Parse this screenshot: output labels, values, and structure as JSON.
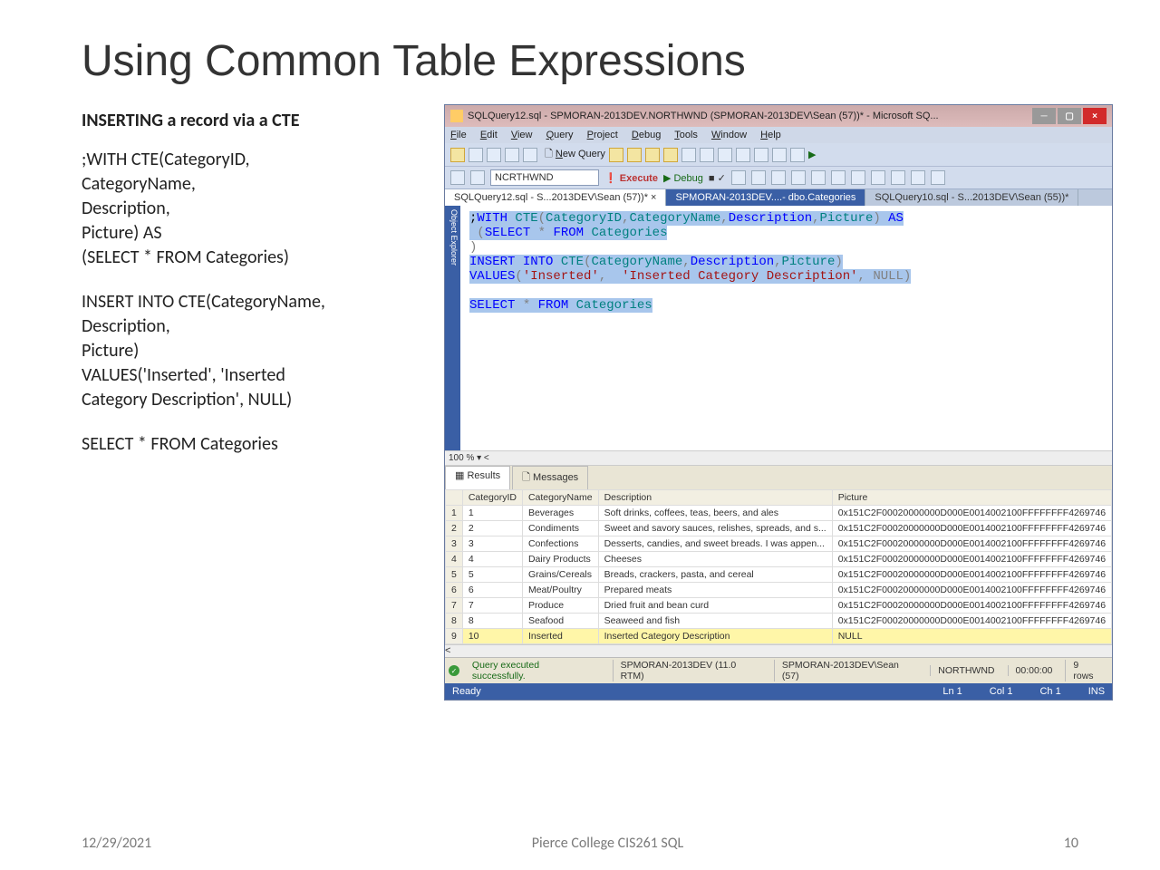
{
  "slide": {
    "title": "Using Common Table Expressions",
    "subheading": "INSERTING a record via a CTE",
    "codeblock1": ";WITH CTE(CategoryID,\nCategoryName,\nDescription,\nPicture) AS\n(SELECT * FROM Categories)",
    "codeblock2": "INSERT INTO CTE(CategoryName,\nDescription,\nPicture)\nVALUES('Inserted', 'Inserted\nCategory Description', NULL)",
    "codeblock3": "SELECT * FROM Categories",
    "footer_date": "12/29/2021",
    "footer_center": "Pierce College CIS261 SQL",
    "footer_page": "10"
  },
  "ssms": {
    "title": "SQLQuery12.sql - SPMORAN-2013DEV.NORTHWND (SPMORAN-2013DEV\\Sean (57))* - Microsoft SQ...",
    "menu": {
      "file": "File",
      "edit": "Edit",
      "view": "View",
      "query": "Query",
      "project": "Project",
      "debug": "Debug",
      "tools": "Tools",
      "window": "Window",
      "help": "Help"
    },
    "newquery": "New Query",
    "db": "NCRTHWND",
    "execute": "Execute",
    "debug": "Debug",
    "tabs": {
      "t1": "SQLQuery12.sql - S...2013DEV\\Sean (57))*",
      "t2": "SPMORAN-2013DEV....- dbo.Categories",
      "t3": "SQLQuery10.sql - S...2013DEV\\Sean (55))*"
    },
    "objexp": "Object Explorer",
    "zoom": "100 %",
    "restabs": {
      "results": "Results",
      "messages": "Messages"
    },
    "columns": {
      "c1": "CategoryID",
      "c2": "CategoryName",
      "c3": "Description",
      "c4": "Picture"
    },
    "rows": [
      {
        "n": "1",
        "id": "1",
        "name": "Beverages",
        "desc": "Soft drinks, coffees, teas, beers, and ales",
        "pic": "0x151C2F00020000000D000E0014002100FFFFFFFF4269746"
      },
      {
        "n": "2",
        "id": "2",
        "name": "Condiments",
        "desc": "Sweet and savory sauces, relishes, spreads, and s...",
        "pic": "0x151C2F00020000000D000E0014002100FFFFFFFF4269746"
      },
      {
        "n": "3",
        "id": "3",
        "name": "Confections",
        "desc": "Desserts, candies, and sweet breads. I was appen...",
        "pic": "0x151C2F00020000000D000E0014002100FFFFFFFF4269746"
      },
      {
        "n": "4",
        "id": "4",
        "name": "Dairy Products",
        "desc": "Cheeses",
        "pic": "0x151C2F00020000000D000E0014002100FFFFFFFF4269746"
      },
      {
        "n": "5",
        "id": "5",
        "name": "Grains/Cereals",
        "desc": "Breads, crackers, pasta, and cereal",
        "pic": "0x151C2F00020000000D000E0014002100FFFFFFFF4269746"
      },
      {
        "n": "6",
        "id": "6",
        "name": "Meat/Poultry",
        "desc": "Prepared meats",
        "pic": "0x151C2F00020000000D000E0014002100FFFFFFFF4269746"
      },
      {
        "n": "7",
        "id": "7",
        "name": "Produce",
        "desc": "Dried fruit and bean curd",
        "pic": "0x151C2F00020000000D000E0014002100FFFFFFFF4269746"
      },
      {
        "n": "8",
        "id": "8",
        "name": "Seafood",
        "desc": "Seaweed and fish",
        "pic": "0x151C2F00020000000D000E0014002100FFFFFFFF4269746"
      },
      {
        "n": "9",
        "id": "10",
        "name": "Inserted",
        "desc": "Inserted Category Description",
        "pic": "NULL"
      }
    ],
    "status": {
      "ok": "Query executed successfully.",
      "server": "SPMORAN-2013DEV (11.0 RTM)",
      "user": "SPMORAN-2013DEV\\Sean (57)",
      "db": "NORTHWND",
      "time": "00:00:00",
      "rows": "9 rows"
    },
    "app": {
      "ready": "Ready",
      "ln": "Ln 1",
      "col": "Col 1",
      "ch": "Ch 1",
      "ins": "INS"
    }
  }
}
